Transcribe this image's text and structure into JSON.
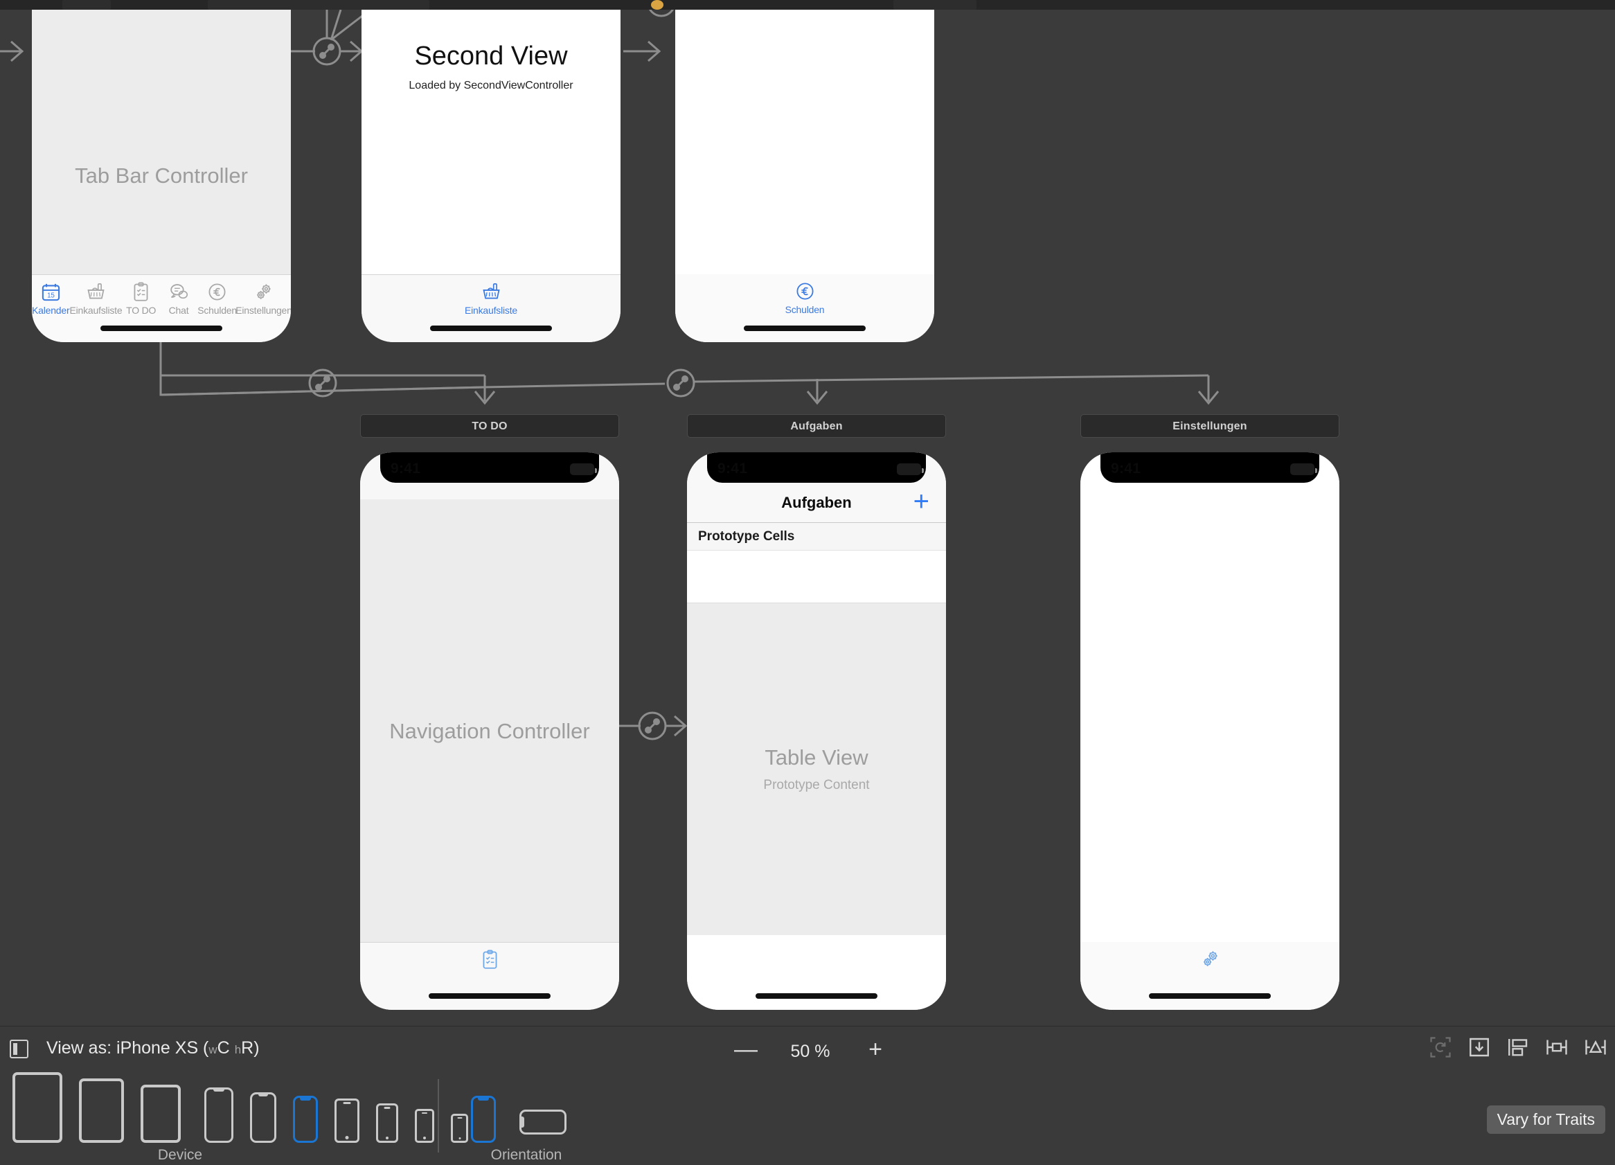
{
  "app": {
    "name": "Xcode Interface Builder – Storyboard Canvas"
  },
  "scenes": [
    {
      "id": "tab-bar-controller",
      "title_bar": null,
      "placeholder_title": "Tab Bar Controller",
      "placeholder_sub": "",
      "tabs": [
        {
          "label": "Kalender",
          "icon": "calendar-icon",
          "selected": true
        },
        {
          "label": "Einkaufsliste",
          "icon": "basket-icon",
          "selected": false
        },
        {
          "label": "TO DO",
          "icon": "clipboard-icon",
          "selected": false
        },
        {
          "label": "Chat",
          "icon": "chat-bubble-icon",
          "selected": false
        },
        {
          "label": "Schulden",
          "icon": "euro-circle-icon",
          "selected": false
        },
        {
          "label": "Einstellungen",
          "icon": "gears-icon",
          "selected": false
        }
      ]
    },
    {
      "id": "second-view",
      "title_bar": null,
      "heading": "Second View",
      "subheading": "Loaded by SecondViewController",
      "tabs": [
        {
          "label": "Einkaufsliste",
          "icon": "basket-icon",
          "selected": true
        }
      ]
    },
    {
      "id": "schulden-view",
      "title_bar": null,
      "heading": "",
      "subheading": "",
      "tabs": [
        {
          "label": "Schulden",
          "icon": "euro-circle-icon",
          "selected": true
        }
      ]
    },
    {
      "id": "navigation-controller",
      "title_bar": "TO DO",
      "placeholder_title": "Navigation Controller",
      "status_time": "9:41",
      "tabs": [
        {
          "label": "",
          "icon": "clipboard-icon",
          "selected": true
        }
      ]
    },
    {
      "id": "aufgaben-table",
      "title_bar": "Aufgaben",
      "status_time": "9:41",
      "nav_title": "Aufgaben",
      "nav_right_button": "add-button",
      "section_header": "Prototype Cells",
      "table_placeholder_title": "Table View",
      "table_placeholder_sub": "Prototype Content"
    },
    {
      "id": "einstellungen-view",
      "title_bar": "Einstellungen",
      "status_time": "9:41",
      "tabs": [
        {
          "label": "",
          "icon": "gears-icon",
          "selected": true
        }
      ]
    }
  ],
  "bottom_bar": {
    "view_as_icon": "preview-panel-icon",
    "view_as_prefix": "View as: iPhone XS (",
    "view_as_w": "w",
    "view_as_wval": "C",
    "view_as_h": "h",
    "view_as_hval": "R",
    "view_as_suffix": ")",
    "zoom_out_label": "—",
    "zoom_value": "50 %",
    "zoom_in_label": "+",
    "autolayout_buttons": [
      {
        "name": "update-frames-icon",
        "enabled": false
      },
      {
        "name": "embed-in-icon",
        "enabled": true
      },
      {
        "name": "align-icon",
        "enabled": true
      },
      {
        "name": "add-constraints-icon",
        "enabled": true
      },
      {
        "name": "resolve-issues-icon",
        "enabled": true
      }
    ]
  },
  "device_bar": {
    "device_group_label": "Device",
    "orientation_group_label": "Orientation",
    "devices": [
      {
        "name": "ipad-pro-12-9",
        "w": 52,
        "h": 72,
        "style": "tablet",
        "selected": false
      },
      {
        "name": "ipad-pro-11",
        "w": 47,
        "h": 66,
        "style": "tablet",
        "selected": false
      },
      {
        "name": "ipad-mini",
        "w": 43,
        "h": 60,
        "style": "tablet",
        "selected": false
      },
      {
        "name": "iphone-11-pro-max",
        "w": 30,
        "h": 56,
        "style": "notch",
        "selected": false
      },
      {
        "name": "iphone-11-pro",
        "w": 28,
        "h": 52,
        "style": "notch",
        "selected": false
      },
      {
        "name": "iphone-xs",
        "w": 26,
        "h": 48,
        "style": "notch",
        "selected": true
      },
      {
        "name": "iphone-8-plus",
        "w": 26,
        "h": 46,
        "style": "home",
        "selected": false
      },
      {
        "name": "iphone-8",
        "w": 23,
        "h": 41,
        "style": "home",
        "selected": false
      },
      {
        "name": "iphone-se",
        "w": 20,
        "h": 36,
        "style": "home",
        "selected": false
      },
      {
        "name": "iphone-4s",
        "w": 18,
        "h": 31,
        "style": "home",
        "selected": false
      }
    ],
    "orientations": [
      {
        "name": "portrait-orientation",
        "selected": true
      },
      {
        "name": "landscape-orientation",
        "selected": false
      }
    ],
    "vary_for_traits_label": "Vary for Traits"
  },
  "colors": {
    "canvas_bg": "#3b3b3b",
    "bar_bg": "#3a3a3a",
    "accent_blue": "#3b7ae0",
    "tint_blue": "#2f7cf6",
    "selection_blue": "#1a76d2",
    "placeholder_grey": "#9d9d9d",
    "scene_fill": "#ececec"
  }
}
